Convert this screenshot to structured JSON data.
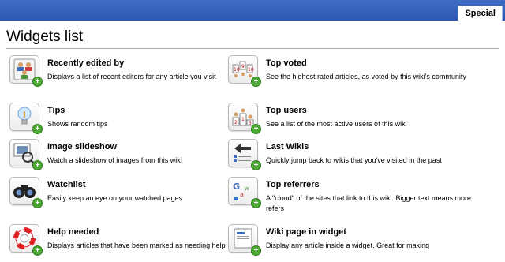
{
  "header": {
    "tab_label": "Special"
  },
  "page": {
    "title": "Widgets list"
  },
  "widgets": [
    {
      "title": "Recently edited by",
      "desc": "Displays a list of recent editors for any article you visit",
      "icon": "editors-icon"
    },
    {
      "title": "Top voted",
      "desc": "See the highest rated articles, as voted by this wiki's community",
      "icon": "top-voted-icon"
    },
    {
      "title": "Tips",
      "desc": "Shows random tips",
      "icon": "lightbulb-icon"
    },
    {
      "title": "Top users",
      "desc": "See a list of the most active users of this wiki",
      "icon": "podium-icon"
    },
    {
      "title": "Image slideshow",
      "desc": "Watch a slideshow of images from this wiki",
      "icon": "slideshow-icon"
    },
    {
      "title": "Last Wikis",
      "desc": "Quickly jump back to wikis that you've visited in the past",
      "icon": "last-wikis-icon"
    },
    {
      "title": "Watchlist",
      "desc": "Easily keep an eye on your watched pages",
      "icon": "binoculars-icon"
    },
    {
      "title": "Top referrers",
      "desc": "A \"cloud\" of the sites that link to this wiki. Bigger text means more refers",
      "icon": "referrers-icon"
    },
    {
      "title": "Help needed",
      "desc": "Displays articles that have been marked as needing help",
      "icon": "lifebuoy-icon"
    },
    {
      "title": "Wiki page in widget",
      "desc": "Display any article inside a widget. Great for making",
      "icon": "wiki-page-icon"
    }
  ],
  "add_badge": "+"
}
